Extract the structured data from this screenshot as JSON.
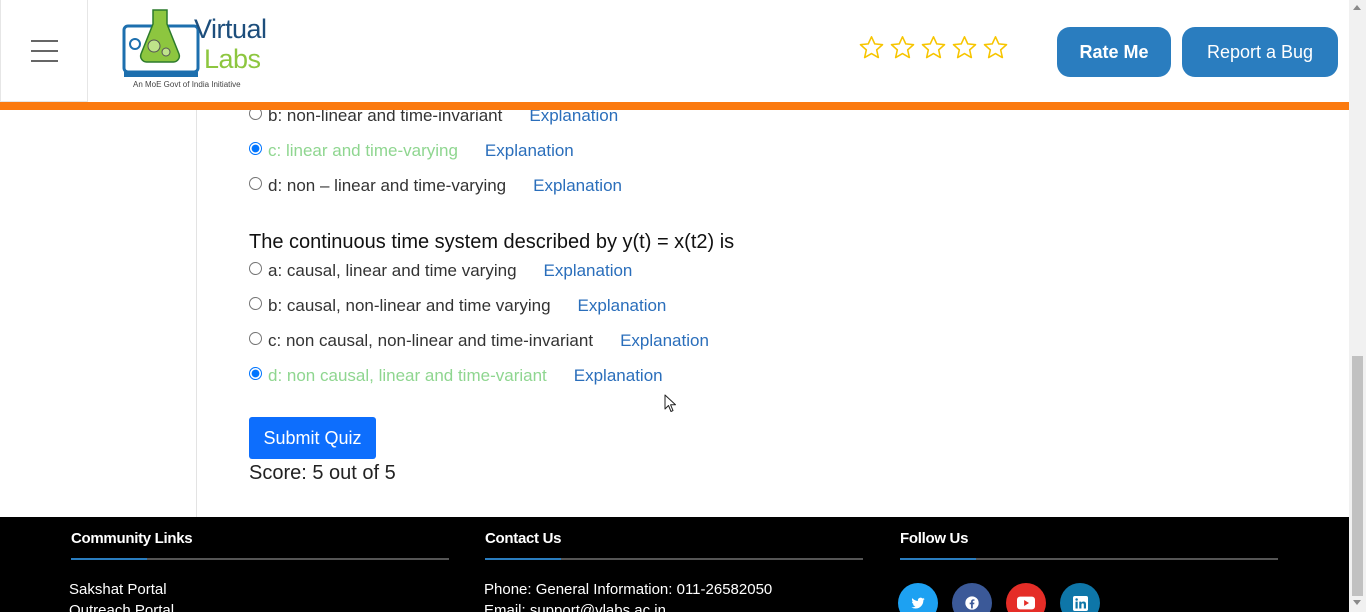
{
  "header": {
    "brand_top": "Virtual",
    "brand_bottom": "Labs",
    "tagline": "An MoE Govt of India Initiative",
    "rate_label": "Rate Me",
    "bug_label": "Report a Bug",
    "star_count": 5,
    "accent_color": "#fb7a0f",
    "button_color": "#2a7dbf",
    "star_color": "#f7c500"
  },
  "quiz": {
    "prev_options": [
      {
        "label": "b: non-linear and time-invariant",
        "explanation": "Explanation",
        "selected": false,
        "correct": false
      },
      {
        "label": "c: linear and time-varying",
        "explanation": "Explanation",
        "selected": true,
        "correct": true
      },
      {
        "label": "d: non – linear and time-varying",
        "explanation": "Explanation",
        "selected": false,
        "correct": false
      }
    ],
    "question": "The continuous time system described by y(t) = x(t2) is",
    "options": [
      {
        "label": "a: causal, linear and time varying",
        "explanation": "Explanation",
        "selected": false,
        "correct": false
      },
      {
        "label": "b: causal, non-linear and time varying",
        "explanation": "Explanation",
        "selected": false,
        "correct": false
      },
      {
        "label": "c: non causal, non-linear and time-invariant",
        "explanation": "Explanation",
        "selected": false,
        "correct": false
      },
      {
        "label": "d: non causal, linear and time-variant",
        "explanation": "Explanation",
        "selected": true,
        "correct": true
      }
    ],
    "submit_label": "Submit Quiz",
    "score": "Score: 5 out of 5",
    "correct_color": "#8fd690",
    "link_color": "#2a6ebb"
  },
  "footer": {
    "community": {
      "heading": "Community Links",
      "links": [
        "Sakshat Portal",
        "Outreach Portal"
      ]
    },
    "contact": {
      "heading": "Contact Us",
      "phone": "Phone: General Information: 011-26582050",
      "email": "Email: support@vlabs.ac.in"
    },
    "follow": {
      "heading": "Follow Us",
      "icons": [
        {
          "name": "twitter-icon",
          "color": "#1da1f2"
        },
        {
          "name": "facebook-icon",
          "color": "#3b5998"
        },
        {
          "name": "youtube-icon",
          "color": "#e52d27"
        },
        {
          "name": "linkedin-icon",
          "color": "#0e76a8"
        }
      ]
    }
  }
}
